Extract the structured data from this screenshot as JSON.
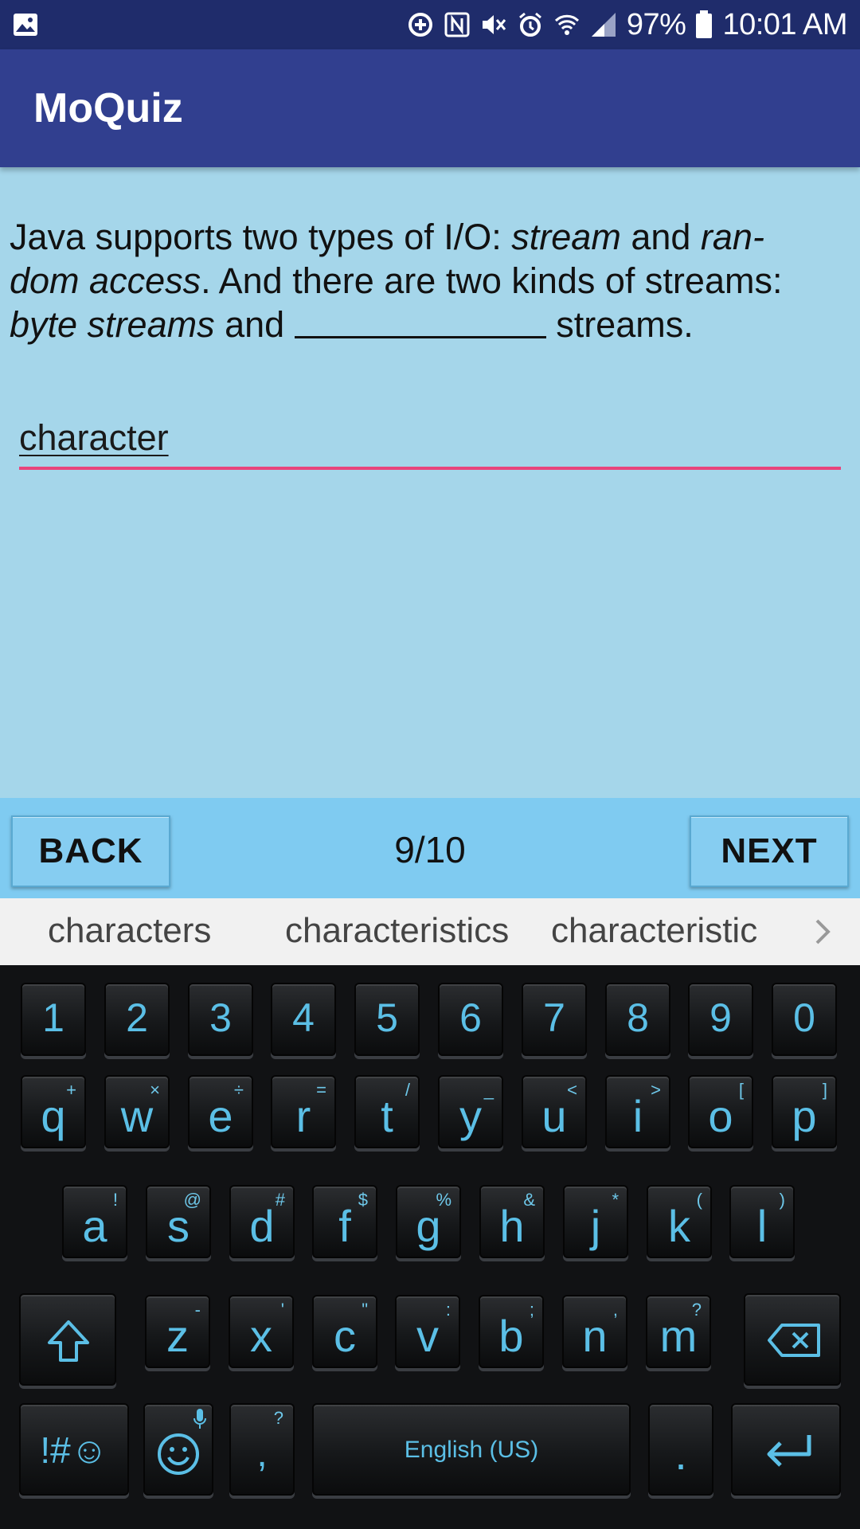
{
  "status_bar": {
    "battery": "97%",
    "time": "10:01 AM",
    "icons": [
      "image-icon",
      "data-saver-icon",
      "nfc-icon",
      "mute-icon",
      "alarm-icon",
      "wifi-icon",
      "signal-icon",
      "battery-icon"
    ]
  },
  "app": {
    "title": "MoQuiz"
  },
  "question": {
    "part1": "Java supports two types of I/O: ",
    "em1": "stream",
    "part2": " and ",
    "em2": "ran-",
    "line2_em": "dom access",
    "line2_rest": ". And there are two kinds of streams:",
    "line3_em": "byte streams",
    "line3_mid": " and ",
    "line3_end": " streams."
  },
  "answer": {
    "value": "character"
  },
  "nav": {
    "back_label": "BACK",
    "next_label": "NEXT",
    "counter": "9/10"
  },
  "suggestions": [
    "characters",
    "characteristics",
    "characteristic"
  ],
  "keyboard": {
    "numbers": [
      "1",
      "2",
      "3",
      "4",
      "5",
      "6",
      "7",
      "8",
      "9",
      "0"
    ],
    "row1": [
      [
        "q",
        "+"
      ],
      [
        "w",
        "×"
      ],
      [
        "e",
        "÷"
      ],
      [
        "r",
        "="
      ],
      [
        "t",
        "/"
      ],
      [
        "y",
        "_"
      ],
      [
        "u",
        "<"
      ],
      [
        "i",
        ">"
      ],
      [
        "o",
        "["
      ],
      [
        "p",
        "]"
      ]
    ],
    "row2": [
      [
        "a",
        "!"
      ],
      [
        "s",
        "@"
      ],
      [
        "d",
        "#"
      ],
      [
        "f",
        "$"
      ],
      [
        "g",
        "%"
      ],
      [
        "h",
        "&"
      ],
      [
        "j",
        "*"
      ],
      [
        "k",
        "("
      ],
      [
        "l",
        ")"
      ]
    ],
    "row3": [
      [
        "z",
        "-"
      ],
      [
        "x",
        "'"
      ],
      [
        "c",
        "\""
      ],
      [
        "v",
        ":"
      ],
      [
        "b",
        ";"
      ],
      [
        "n",
        ","
      ],
      [
        "m",
        "?"
      ]
    ],
    "symbols_label": "!#☺",
    "comma": ",",
    "comma_sub": "?",
    "space_label": "English (US)",
    "period": "."
  },
  "colors": {
    "status_bar": "#1f2c6b",
    "app_bar": "#313f8f",
    "content_bg": "#a5d6ea",
    "nav_bg": "#7fcbf1",
    "input_underline": "#e8457c",
    "key_text": "#5bbfe6"
  }
}
